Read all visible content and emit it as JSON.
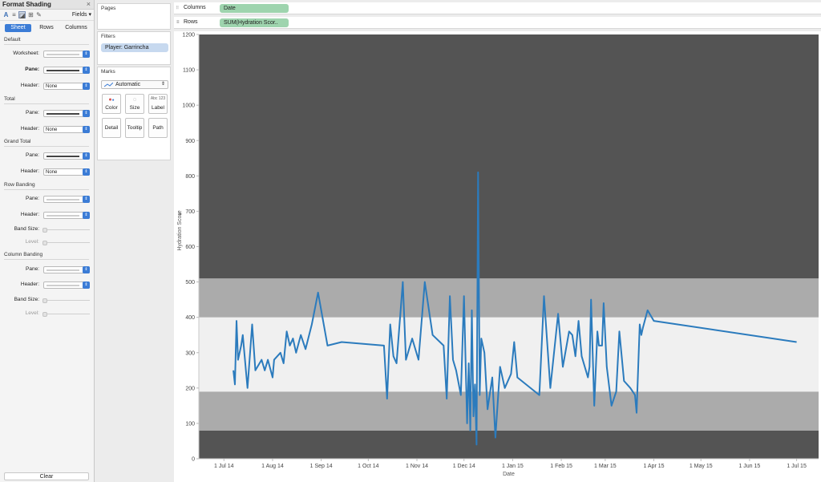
{
  "format_panel": {
    "title": "Format Shading",
    "close": "×",
    "fields_label": "Fields",
    "tabs": [
      "Sheet",
      "Rows",
      "Columns"
    ],
    "sections": {
      "default": "Default",
      "total": "Total",
      "grand_total": "Grand Total",
      "row_banding": "Row Banding",
      "column_banding": "Column Banding"
    },
    "labels": {
      "worksheet": "Worksheet:",
      "pane": "Pane:",
      "header": "Header:",
      "band_size": "Band Size:",
      "level": "Level:"
    },
    "header_value": "None",
    "clear_label": "Clear"
  },
  "cards": {
    "pages": "Pages",
    "filters": "Filters",
    "filter_pill": "Player: Garrincha",
    "marks": "Marks",
    "mark_type": "Automatic",
    "mark_buttons": [
      "Color",
      "Size",
      "Label",
      "Detail",
      "Tooltip",
      "Path"
    ],
    "label_glyph": "Abc 123"
  },
  "shelves": {
    "columns_label": "Columns",
    "columns_pill": "Date",
    "rows_label": "Rows",
    "rows_pill": "SUM(Hydration Scor.."
  },
  "colors": {
    "accent": "#3b7cd6",
    "line": "#2b7bbd",
    "band_dark": "#545454",
    "band_mid": "#ababab",
    "band_light": "#f0f0f0",
    "filter_pill": "#c7d9ef",
    "shelf_pill": "#9ed4ae"
  },
  "chart_data": {
    "type": "line",
    "xlabel": "Date",
    "ylabel": "Hydration Score",
    "ylim": [
      0,
      1200
    ],
    "yticks": [
      0,
      100,
      200,
      300,
      400,
      500,
      600,
      700,
      800,
      900,
      1000,
      1100,
      1200
    ],
    "xlim": [
      "2014-06-15",
      "2015-07-15"
    ],
    "xticks": [
      {
        "date": "2014-07-01",
        "label": "1 Jul 14"
      },
      {
        "date": "2014-08-01",
        "label": "1 Aug 14"
      },
      {
        "date": "2014-09-01",
        "label": "1 Sep 14"
      },
      {
        "date": "2014-10-01",
        "label": "1 Oct 14"
      },
      {
        "date": "2014-11-01",
        "label": "1 Nov 14"
      },
      {
        "date": "2014-12-01",
        "label": "1 Dec 14"
      },
      {
        "date": "2015-01-01",
        "label": "1 Jan 15"
      },
      {
        "date": "2015-02-01",
        "label": "1 Feb 15"
      },
      {
        "date": "2015-03-01",
        "label": "1 Mar 15"
      },
      {
        "date": "2015-04-01",
        "label": "1 Apr 15"
      },
      {
        "date": "2015-05-01",
        "label": "1 May 15"
      },
      {
        "date": "2015-06-01",
        "label": "1 Jun 15"
      },
      {
        "date": "2015-07-01",
        "label": "1 Jul 15"
      }
    ],
    "bands": [
      {
        "from": 0,
        "to": 80,
        "shade": "dark"
      },
      {
        "from": 80,
        "to": 190,
        "shade": "mid"
      },
      {
        "from": 190,
        "to": 400,
        "shade": "light"
      },
      {
        "from": 400,
        "to": 510,
        "shade": "mid"
      },
      {
        "from": 510,
        "to": 1200,
        "shade": "dark"
      }
    ],
    "series": [
      {
        "points": [
          [
            "2014-07-07",
            250
          ],
          [
            "2014-07-08",
            210
          ],
          [
            "2014-07-09",
            390
          ],
          [
            "2014-07-10",
            280
          ],
          [
            "2014-07-12",
            320
          ],
          [
            "2014-07-13",
            350
          ],
          [
            "2014-07-15",
            250
          ],
          [
            "2014-07-16",
            200
          ],
          [
            "2014-07-19",
            380
          ],
          [
            "2014-07-21",
            250
          ],
          [
            "2014-07-25",
            280
          ],
          [
            "2014-07-27",
            250
          ],
          [
            "2014-07-29",
            280
          ],
          [
            "2014-08-01",
            230
          ],
          [
            "2014-08-02",
            280
          ],
          [
            "2014-08-06",
            300
          ],
          [
            "2014-08-08",
            270
          ],
          [
            "2014-08-10",
            360
          ],
          [
            "2014-08-12",
            320
          ],
          [
            "2014-08-14",
            340
          ],
          [
            "2014-08-16",
            300
          ],
          [
            "2014-08-19",
            350
          ],
          [
            "2014-08-22",
            310
          ],
          [
            "2014-08-26",
            380
          ],
          [
            "2014-08-30",
            470
          ],
          [
            "2014-09-05",
            320
          ],
          [
            "2014-09-14",
            330
          ],
          [
            "2014-10-11",
            320
          ],
          [
            "2014-10-13",
            170
          ],
          [
            "2014-10-15",
            380
          ],
          [
            "2014-10-17",
            290
          ],
          [
            "2014-10-19",
            270
          ],
          [
            "2014-10-23",
            500
          ],
          [
            "2014-10-25",
            280
          ],
          [
            "2014-10-29",
            340
          ],
          [
            "2014-11-02",
            280
          ],
          [
            "2014-11-06",
            500
          ],
          [
            "2014-11-11",
            350
          ],
          [
            "2014-11-18",
            320
          ],
          [
            "2014-11-20",
            170
          ],
          [
            "2014-11-22",
            460
          ],
          [
            "2014-11-24",
            280
          ],
          [
            "2014-11-26",
            250
          ],
          [
            "2014-11-29",
            180
          ],
          [
            "2014-12-01",
            460
          ],
          [
            "2014-12-03",
            100
          ],
          [
            "2014-12-04",
            270
          ],
          [
            "2014-12-05",
            80
          ],
          [
            "2014-12-06",
            420
          ],
          [
            "2014-12-07",
            120
          ],
          [
            "2014-12-08",
            210
          ],
          [
            "2014-12-09",
            40
          ],
          [
            "2014-12-10",
            810
          ],
          [
            "2014-12-11",
            180
          ],
          [
            "2014-12-12",
            340
          ],
          [
            "2014-12-14",
            300
          ],
          [
            "2014-12-16",
            140
          ],
          [
            "2014-12-19",
            230
          ],
          [
            "2014-12-21",
            60
          ],
          [
            "2014-12-24",
            260
          ],
          [
            "2014-12-27",
            200
          ],
          [
            "2014-12-31",
            240
          ],
          [
            "2015-01-02",
            330
          ],
          [
            "2015-01-04",
            230
          ],
          [
            "2015-01-18",
            180
          ],
          [
            "2015-01-21",
            460
          ],
          [
            "2015-01-25",
            200
          ],
          [
            "2015-01-30",
            410
          ],
          [
            "2015-02-02",
            260
          ],
          [
            "2015-02-06",
            360
          ],
          [
            "2015-02-08",
            350
          ],
          [
            "2015-02-10",
            290
          ],
          [
            "2015-02-12",
            390
          ],
          [
            "2015-02-14",
            290
          ],
          [
            "2015-02-18",
            230
          ],
          [
            "2015-02-19",
            260
          ],
          [
            "2015-02-20",
            450
          ],
          [
            "2015-02-22",
            150
          ],
          [
            "2015-02-24",
            360
          ],
          [
            "2015-02-25",
            320
          ],
          [
            "2015-02-27",
            320
          ],
          [
            "2015-02-28",
            440
          ],
          [
            "2015-03-02",
            260
          ],
          [
            "2015-03-05",
            150
          ],
          [
            "2015-03-08",
            190
          ],
          [
            "2015-03-10",
            360
          ],
          [
            "2015-03-13",
            220
          ],
          [
            "2015-03-17",
            200
          ],
          [
            "2015-03-20",
            180
          ],
          [
            "2015-03-21",
            130
          ],
          [
            "2015-03-23",
            380
          ],
          [
            "2015-03-24",
            350
          ],
          [
            "2015-03-25",
            370
          ],
          [
            "2015-03-28",
            420
          ],
          [
            "2015-04-01",
            390
          ],
          [
            "2015-07-01",
            330
          ]
        ]
      }
    ]
  }
}
